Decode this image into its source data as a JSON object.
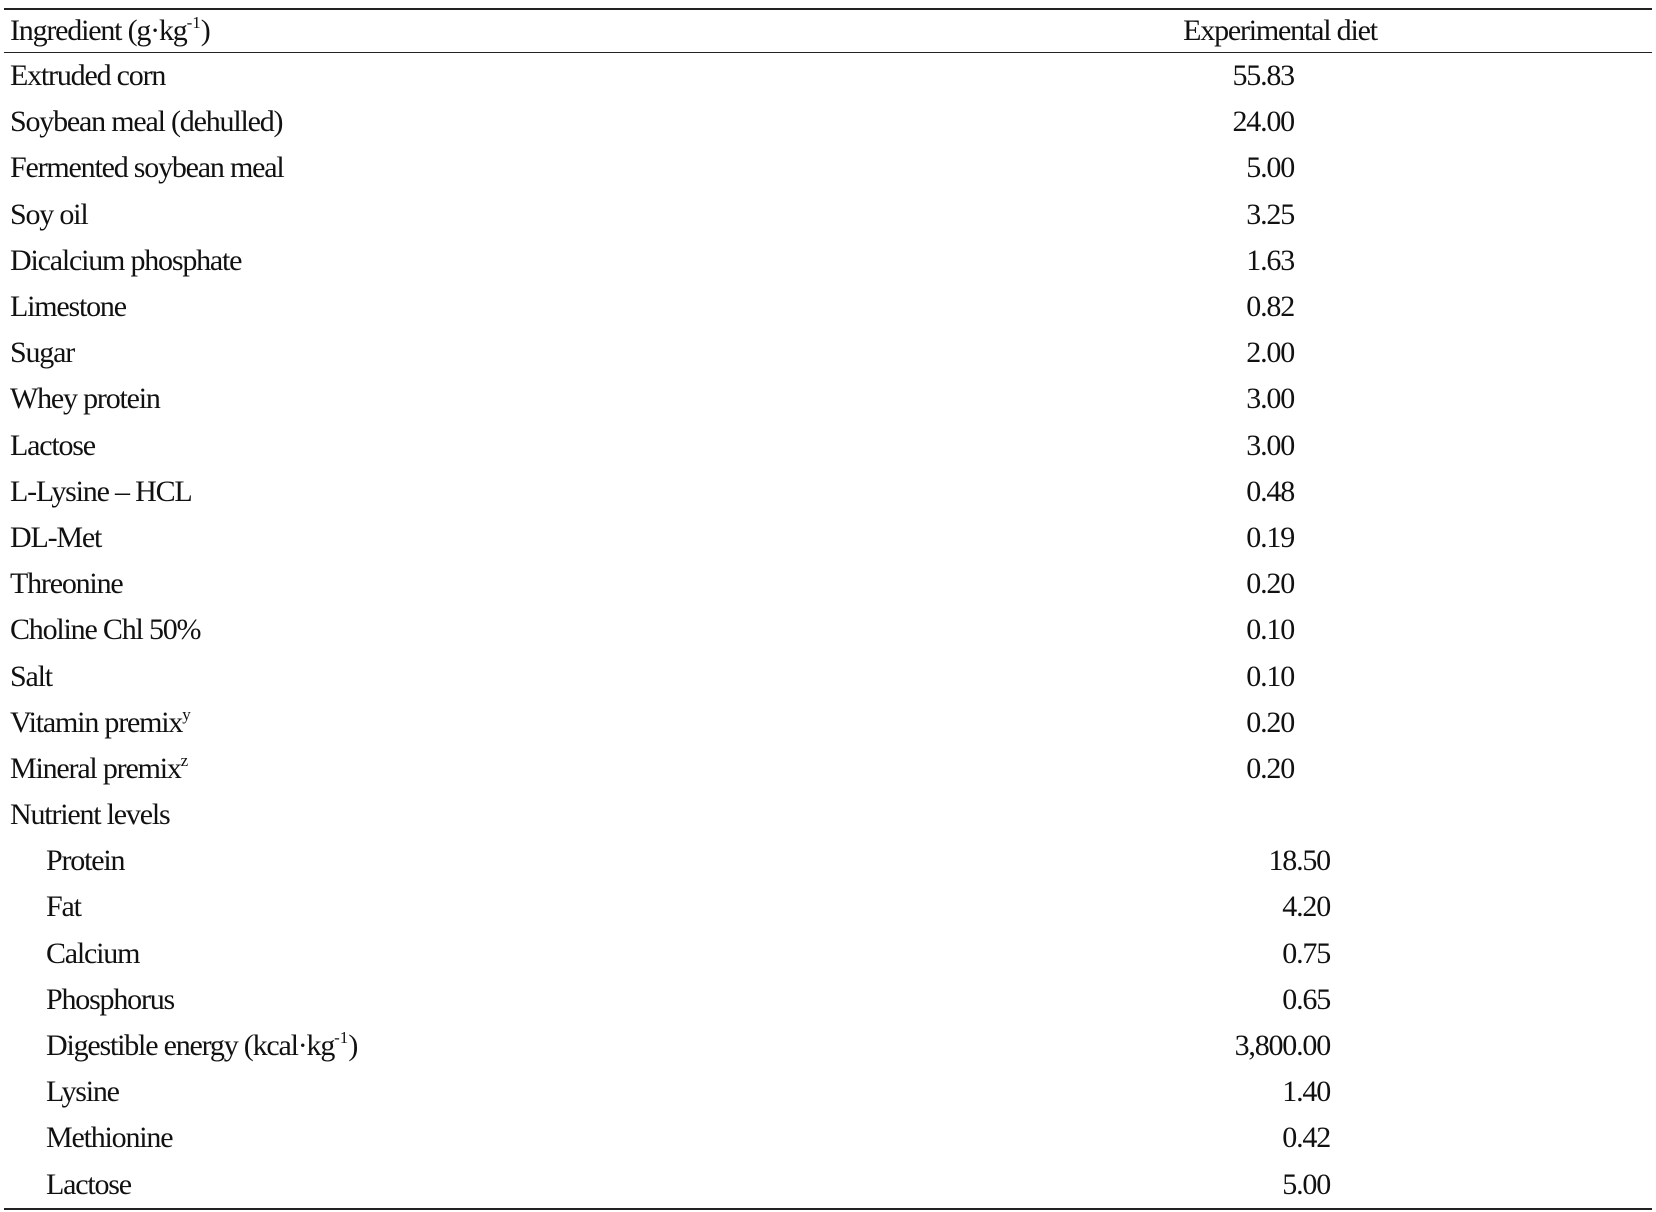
{
  "table": {
    "header": {
      "ingredient_label": "Ingredient (g·kg",
      "ingredient_sup": "-1",
      "ingredient_close": ")",
      "diet_label": "Experimental diet"
    },
    "rows": [
      {
        "label": "Extruded corn",
        "sup": "",
        "value": "55.83"
      },
      {
        "label": "Soybean meal (dehulled)",
        "sup": "",
        "value": "24.00"
      },
      {
        "label": "Fermented soybean meal",
        "sup": "",
        "value": "5.00"
      },
      {
        "label": "Soy oil",
        "sup": "",
        "value": "3.25"
      },
      {
        "label": "Dicalcium phosphate",
        "sup": "",
        "value": "1.63"
      },
      {
        "label": "Limestone",
        "sup": "",
        "value": "0.82"
      },
      {
        "label": "Sugar",
        "sup": "",
        "value": "2.00"
      },
      {
        "label": "Whey protein",
        "sup": "",
        "value": "3.00"
      },
      {
        "label": "Lactose",
        "sup": "",
        "value": "3.00"
      },
      {
        "label": "L-Lysine – HCL",
        "sup": "",
        "value": "0.48"
      },
      {
        "label": "DL-Met",
        "sup": "",
        "value": "0.19"
      },
      {
        "label": "Threonine",
        "sup": "",
        "value": "0.20"
      },
      {
        "label": "Choline Chl 50%",
        "sup": "",
        "value": "0.10"
      },
      {
        "label": "Salt",
        "sup": "",
        "value": "0.10"
      },
      {
        "label": "Vitamin premix",
        "sup": "y",
        "value": "0.20"
      },
      {
        "label": "Mineral premix",
        "sup": "z",
        "value": "0.20"
      }
    ],
    "nutrient_section_label": "Nutrient levels",
    "nutrients": [
      {
        "label": "Protein",
        "sup": "",
        "value": "18.50"
      },
      {
        "label": "Fat",
        "sup": "",
        "value": "4.20"
      },
      {
        "label": "Calcium",
        "sup": "",
        "value": "0.75"
      },
      {
        "label": "Phosphorus",
        "sup": "",
        "value": "0.65"
      },
      {
        "label": "Digestible energy (kcal·kg",
        "sup": "-1",
        "close": ")",
        "value": "3,800.00"
      },
      {
        "label": "Lysine",
        "sup": "",
        "value": "1.40"
      },
      {
        "label": "Methionine",
        "sup": "",
        "value": "0.42"
      },
      {
        "label": "Lactose",
        "sup": "",
        "value": "5.00"
      }
    ]
  }
}
